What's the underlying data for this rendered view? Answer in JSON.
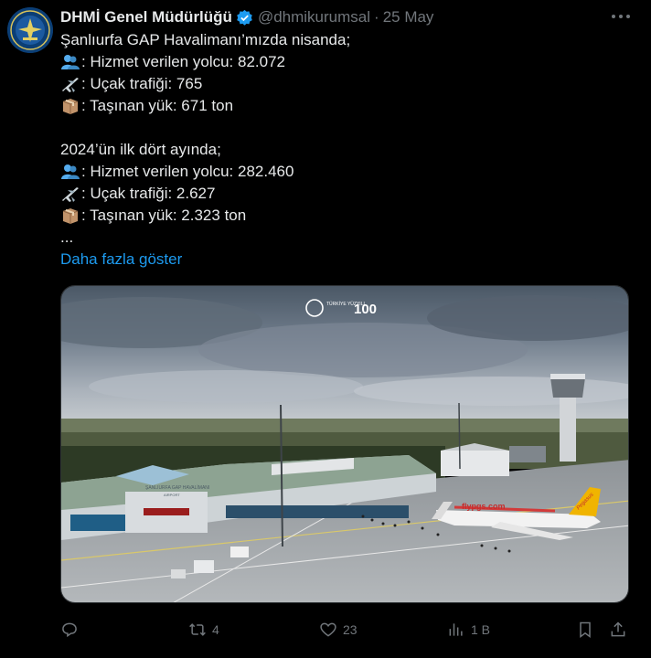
{
  "author": {
    "name": "DHMİ Genel Müdürlüğü",
    "handle": "@dhmikurumsal",
    "separator": "·",
    "date": "25 May"
  },
  "tweet": {
    "lines": [
      {
        "emoji": null,
        "text": "Şanlıurfa GAP Havalimanı’mızda nisanda;"
      },
      {
        "emoji": "people-icon",
        "text": ": Hizmet verilen yolcu: 82.072"
      },
      {
        "emoji": "airplane-icon",
        "text": ": Uçak trafiği: 765"
      },
      {
        "emoji": "package-icon",
        "text": ": Taşınan yük: 671 ton"
      },
      {
        "emoji": null,
        "text": ""
      },
      {
        "emoji": null,
        "text": "2024’ün ilk dört ayında;"
      },
      {
        "emoji": "people-icon",
        "text": ": Hizmet verilen yolcu: 282.460"
      },
      {
        "emoji": "airplane-icon",
        "text": ": Uçak trafiği: 2.627"
      },
      {
        "emoji": "package-icon",
        "text": ": Taşınan yük: 2.323 ton"
      },
      {
        "emoji": null,
        "text": "..."
      }
    ],
    "show_more": "Daha fazla göster"
  },
  "media": {
    "watermark_left": "TÜRKİYE YÜZYILI",
    "watermark_right": "100",
    "terminal_sign": "ŞANLIURFA GAP HAVALİMANI",
    "terminal_sub": "AIRPORT",
    "aircraft_livery": "flypgs.com",
    "aircraft_tail": "Pegasus"
  },
  "actions": {
    "reply_count": "",
    "retweet_count": "4",
    "like_count": "23",
    "views_count": "1 B"
  },
  "colors": {
    "background": "#000000",
    "text": "#e7e9ea",
    "muted": "#71767b",
    "link": "#1d9bf0",
    "verified": "#1d9bf0"
  }
}
